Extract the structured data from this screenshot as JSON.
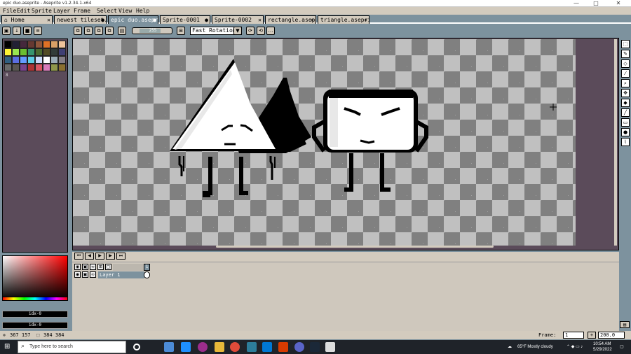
{
  "window": {
    "title": "epic duo.aseprite - Aseprite v1.2.34.1-x64",
    "minimize": "—",
    "maximize": "□",
    "close": "✕"
  },
  "menu": [
    "File",
    "Edit",
    "Sprite",
    "Layer",
    "Frame",
    "Select",
    "View",
    "Help"
  ],
  "tabs": [
    {
      "label": "Home",
      "active": false
    },
    {
      "label": "newest tileset.a",
      "active": false
    },
    {
      "label": "epic duo.asepri",
      "active": true
    },
    {
      "label": "Sprite-0001",
      "active": false
    },
    {
      "label": "Sprite-0002",
      "active": false
    },
    {
      "label": "rectangle.asepr",
      "active": false
    },
    {
      "label": "triangle.aseprite",
      "active": false
    }
  ],
  "toolbar": {
    "rotation_mode": "Fast Rotation",
    "opacity_label": "255"
  },
  "palette": {
    "colors": [
      "#000000",
      "#222034",
      "#45283c",
      "#663931",
      "#8f563b",
      "#df7126",
      "#d9a066",
      "#eec39a",
      "#fbf236",
      "#99e550",
      "#6abe30",
      "#37946e",
      "#4b692f",
      "#524b24",
      "#323c39",
      "#3f3f74",
      "#306082",
      "#5b6ee1",
      "#639bff",
      "#5fcde4",
      "#cbdbfc",
      "#ffffff",
      "#9badb7",
      "#847e87",
      "#696a6a",
      "#595652",
      "#76428a",
      "#ac3232",
      "#d95763",
      "#d77bba",
      "#8f974a",
      "#8a6f30"
    ],
    "info": "8"
  },
  "color_fields": {
    "fg": "idx-0",
    "bg": "idx-0"
  },
  "timeline": {
    "buttons": [
      "⏮",
      "◀",
      "▶",
      "▶",
      "⏭"
    ],
    "layer_name": "Layer 1",
    "frame_number": "1"
  },
  "status": {
    "cursor": "367 157",
    "size": "384 384",
    "frame_label": "Frame:",
    "frame_value": "1",
    "zoom": "200.0"
  },
  "taskbar": {
    "search_placeholder": "Type here to search",
    "weather": "65°F  Mostly cloudy",
    "time": "10:54 AM",
    "date": "5/29/2022"
  }
}
